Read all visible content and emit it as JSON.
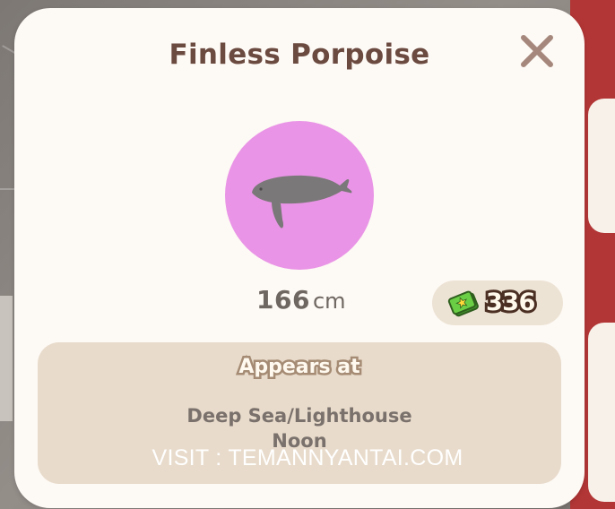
{
  "creature": {
    "name": "Finless Porpoise",
    "icon": "porpoise-icon",
    "size_value": "166",
    "size_unit": "cm",
    "price": "336",
    "price_icon": "money-icon"
  },
  "appears": {
    "heading": "Appears at",
    "location": "Deep Sea/Lighthouse",
    "time": "Noon"
  },
  "controls": {
    "close_icon": "close-icon"
  },
  "watermark": "VISIT : TEMANNYANTAI.COM",
  "colors": {
    "title": "#6b4a40",
    "circle": "#e994e6",
    "panel": "#fdf9f4",
    "appears_box": "#e8dbcb",
    "price_pill": "#ede3d5",
    "money_green": "#5fc23f"
  }
}
